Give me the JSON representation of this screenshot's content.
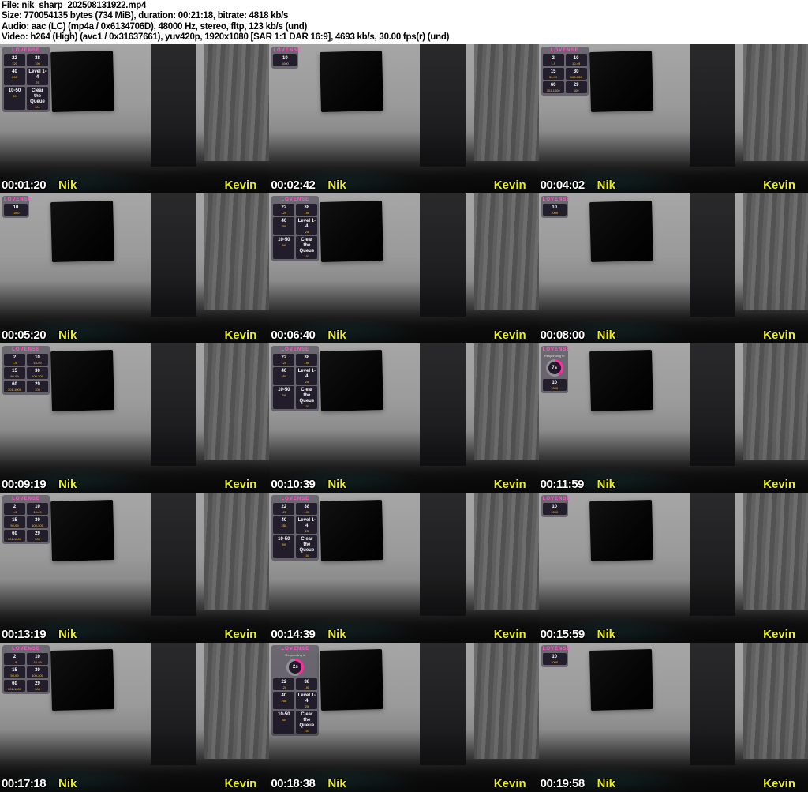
{
  "header": {
    "lines": [
      "File: nik_sharp_202508131922.mp4",
      "Size: 770054135 bytes (734 MiB), duration: 00:21:18, bitrate: 4818 kb/s",
      "Audio: aac (LC) (mp4a / 0x6134706D), 48000 Hz, stereo, fltp, 123 kb/s (und)",
      "Video: h264 (High) (avc1 / 0x31637661), yuv420p, 1920x1080 [SAR 1:1 DAR 16:9], 4693 kb/s, 30.00 fps(r) (und)"
    ]
  },
  "watermarks": {
    "left": "Nik",
    "right": "Kevin"
  },
  "overlays": {
    "brand": "LOVENSE",
    "responding_label": "Responding in",
    "menus": {
      "menuA": [
        {
          "label": "22",
          "sub": "120"
        },
        {
          "label": "38",
          "sub": "190"
        },
        {
          "label": "40",
          "sub": "250"
        },
        {
          "label": "Level 1-4",
          "sub": "25"
        },
        {
          "label": "10-50",
          "sub": "50"
        },
        {
          "label": "Clear the Queue",
          "sub": "101"
        }
      ],
      "menuB": [
        {
          "label": "2",
          "sub": "1-9"
        },
        {
          "label": "10",
          "sub": "10-49"
        },
        {
          "label": "15",
          "sub": "50-99"
        },
        {
          "label": "30",
          "sub": "100-300"
        },
        {
          "label": "60",
          "sub": "301-1000"
        },
        {
          "label": "29",
          "sub": "100"
        }
      ],
      "mini": [
        {
          "label": "10",
          "sub": "1000"
        }
      ]
    }
  },
  "grid": {
    "columns": 3,
    "rows": 5,
    "thumbnails": [
      {
        "timestamp": "00:01:20",
        "menu": "menuA",
        "ring": null
      },
      {
        "timestamp": "00:02:42",
        "menu": "mini",
        "ring": null
      },
      {
        "timestamp": "00:04:02",
        "menu": "menuB",
        "ring": null
      },
      {
        "timestamp": "00:05:20",
        "menu": "mini",
        "ring": null
      },
      {
        "timestamp": "00:06:40",
        "menu": "menuA",
        "ring": null
      },
      {
        "timestamp": "00:08:00",
        "menu": "mini",
        "ring": null
      },
      {
        "timestamp": "00:09:19",
        "menu": "menuB",
        "ring": null
      },
      {
        "timestamp": "00:10:39",
        "menu": "menuA",
        "ring": null
      },
      {
        "timestamp": "00:11:59",
        "menu": "mini",
        "ring": "7s"
      },
      {
        "timestamp": "00:13:19",
        "menu": "menuB",
        "ring": null
      },
      {
        "timestamp": "00:14:39",
        "menu": "menuA",
        "ring": null
      },
      {
        "timestamp": "00:15:59",
        "menu": "mini",
        "ring": null
      },
      {
        "timestamp": "00:17:18",
        "menu": "menuB",
        "ring": null
      },
      {
        "timestamp": "00:18:38",
        "menu": "menuA",
        "ring": "2s"
      },
      {
        "timestamp": "00:19:58",
        "menu": "mini",
        "ring": null
      }
    ]
  },
  "colors": {
    "header_bg": "#ffffff",
    "header_text": "#000000",
    "timestamp_text": "#ffffff",
    "watermark_yellow": "#e8ef1a",
    "lovense_pink": "#ff57c9",
    "ring_magenta": "#ff2da0",
    "token_yellow": "#ffcf40"
  }
}
